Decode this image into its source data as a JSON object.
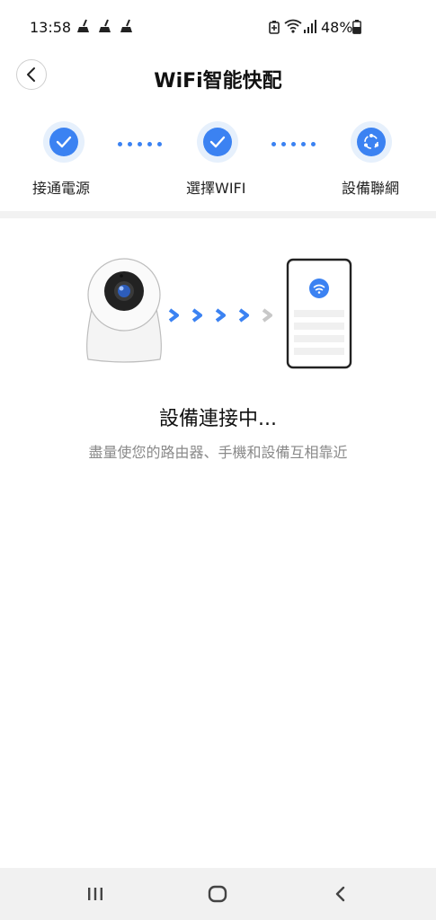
{
  "status_bar": {
    "time": "13:58",
    "battery": "48%",
    "left_icons": [
      "broom-icon",
      "broom-icon",
      "broom-icon"
    ],
    "right_icons": [
      "battery-saver-icon",
      "wifi-icon",
      "signal-icon",
      "battery-icon"
    ]
  },
  "header": {
    "title": "WiFi智能快配",
    "back_icon": "chevron-left-icon"
  },
  "stepper": {
    "steps": [
      {
        "label": "接通電源",
        "state": "done",
        "icon": "check-icon"
      },
      {
        "label": "選擇WIFI",
        "state": "done",
        "icon": "check-icon"
      },
      {
        "label": "設備聯網",
        "state": "active",
        "icon": "network-icon"
      }
    ],
    "accent_color": "#3b82f2"
  },
  "illustration": {
    "device": "camera-icon",
    "target": "phone-icon",
    "arrows_active": 4,
    "arrows_total": 5
  },
  "status": {
    "title": "設備連接中...",
    "hint": "盡量使您的路由器、手機和設備互相靠近"
  },
  "nav_bar": {
    "buttons": [
      "recent-apps-icon",
      "home-icon",
      "back-icon"
    ]
  }
}
